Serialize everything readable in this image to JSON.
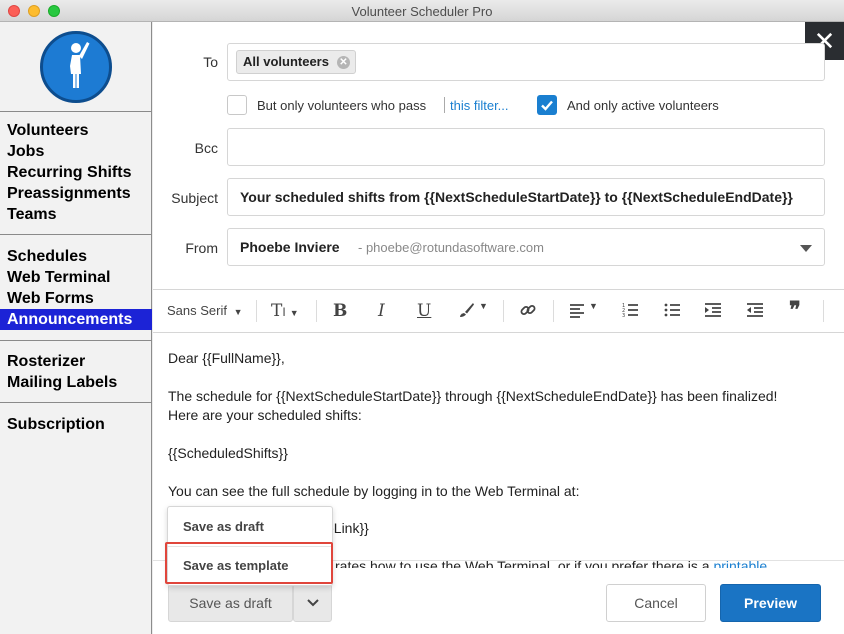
{
  "window": {
    "title": "Volunteer Scheduler Pro"
  },
  "sidebar": {
    "logo_icon": "volunteer-raising-hand-icon",
    "groups": [
      [
        "Volunteers",
        "Jobs",
        "Recurring Shifts",
        "Preassignments",
        "Teams"
      ],
      [
        "Schedules",
        "Web Terminal",
        "Web Forms",
        "Announcements"
      ],
      [
        "Rosterizer",
        "Mailing Labels"
      ],
      [
        "Subscription"
      ]
    ],
    "active": "Announcements"
  },
  "form": {
    "to_label": "To",
    "to_chip": "All volunteers",
    "filter_checkbox_label": "But only volunteers who pass",
    "filter_link": "this filter...",
    "filter_checked": false,
    "active_checkbox_label": "And only active volunteers",
    "active_checked": true,
    "bcc_label": "Bcc",
    "bcc_value": "",
    "subject_label": "Subject",
    "subject_value": "Your scheduled shifts from {{NextScheduleStartDate}} to {{NextScheduleEndDate}}",
    "from_label": "From",
    "from_name": "Phoebe Inviere",
    "from_email": "- phoebe@rotundasoftware.com"
  },
  "toolbar": {
    "font_label": "Sans Serif",
    "icons": [
      "text-size-icon",
      "bold-icon",
      "italic-icon",
      "underline-icon",
      "brush-icon",
      "link-icon",
      "align-icon",
      "ordered-list-icon",
      "bullet-list-icon",
      "indent-icon",
      "outdent-icon",
      "quote-icon"
    ]
  },
  "body": {
    "line1": "Dear {{FullName}},",
    "line2": "The schedule for {{NextScheduleStartDate}} through {{NextScheduleEndDate}} has been finalized!",
    "line3": "Here are your scheduled shifts:",
    "line4": "{{ScheduledShifts}}",
    "line5": "You can see the full schedule by logging in to the Web Terminal at:",
    "line6_partial": "eLink}}",
    "line7_partial": "rates how to use the Web Terminal, or if you prefer there is a",
    "line7_link": "printable"
  },
  "dropdown": {
    "items": [
      "Save as draft",
      "Save as template"
    ],
    "highlighted": "Save as template"
  },
  "footer": {
    "save_draft": "Save as draft",
    "cancel": "Cancel",
    "preview": "Preview"
  },
  "colors": {
    "active_nav": "#1c23d6",
    "primary": "#1a74c4",
    "highlight_border": "#e0453b"
  }
}
